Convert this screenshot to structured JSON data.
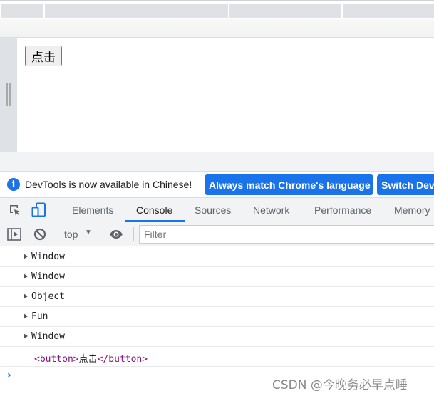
{
  "page": {
    "button_label": "点击"
  },
  "infobar": {
    "message": "DevTools is now available in Chinese!",
    "primary_button": "Always match Chrome's language",
    "secondary_button": "Switch Dev"
  },
  "devtools": {
    "tabs": [
      {
        "label": "Elements",
        "active": false
      },
      {
        "label": "Console",
        "active": true
      },
      {
        "label": "Sources",
        "active": false
      },
      {
        "label": "Network",
        "active": false
      },
      {
        "label": "Performance",
        "active": false
      },
      {
        "label": "Memory",
        "active": false
      }
    ],
    "accent_color": "#1a73e8"
  },
  "console_toolbar": {
    "context": "top",
    "filter_placeholder": "Filter"
  },
  "console": {
    "messages": [
      {
        "text": "Window",
        "expandable": true
      },
      {
        "text": "Window",
        "expandable": true
      },
      {
        "text": "Object",
        "expandable": true
      },
      {
        "text": "Fun",
        "expandable": true
      },
      {
        "text": "Window",
        "expandable": true
      }
    ],
    "element_log": {
      "open_tag": "<button>",
      "content": "点击",
      "close_tag": "</button>"
    },
    "prompt": "›"
  },
  "watermark": "CSDN @今晚务必早点睡"
}
